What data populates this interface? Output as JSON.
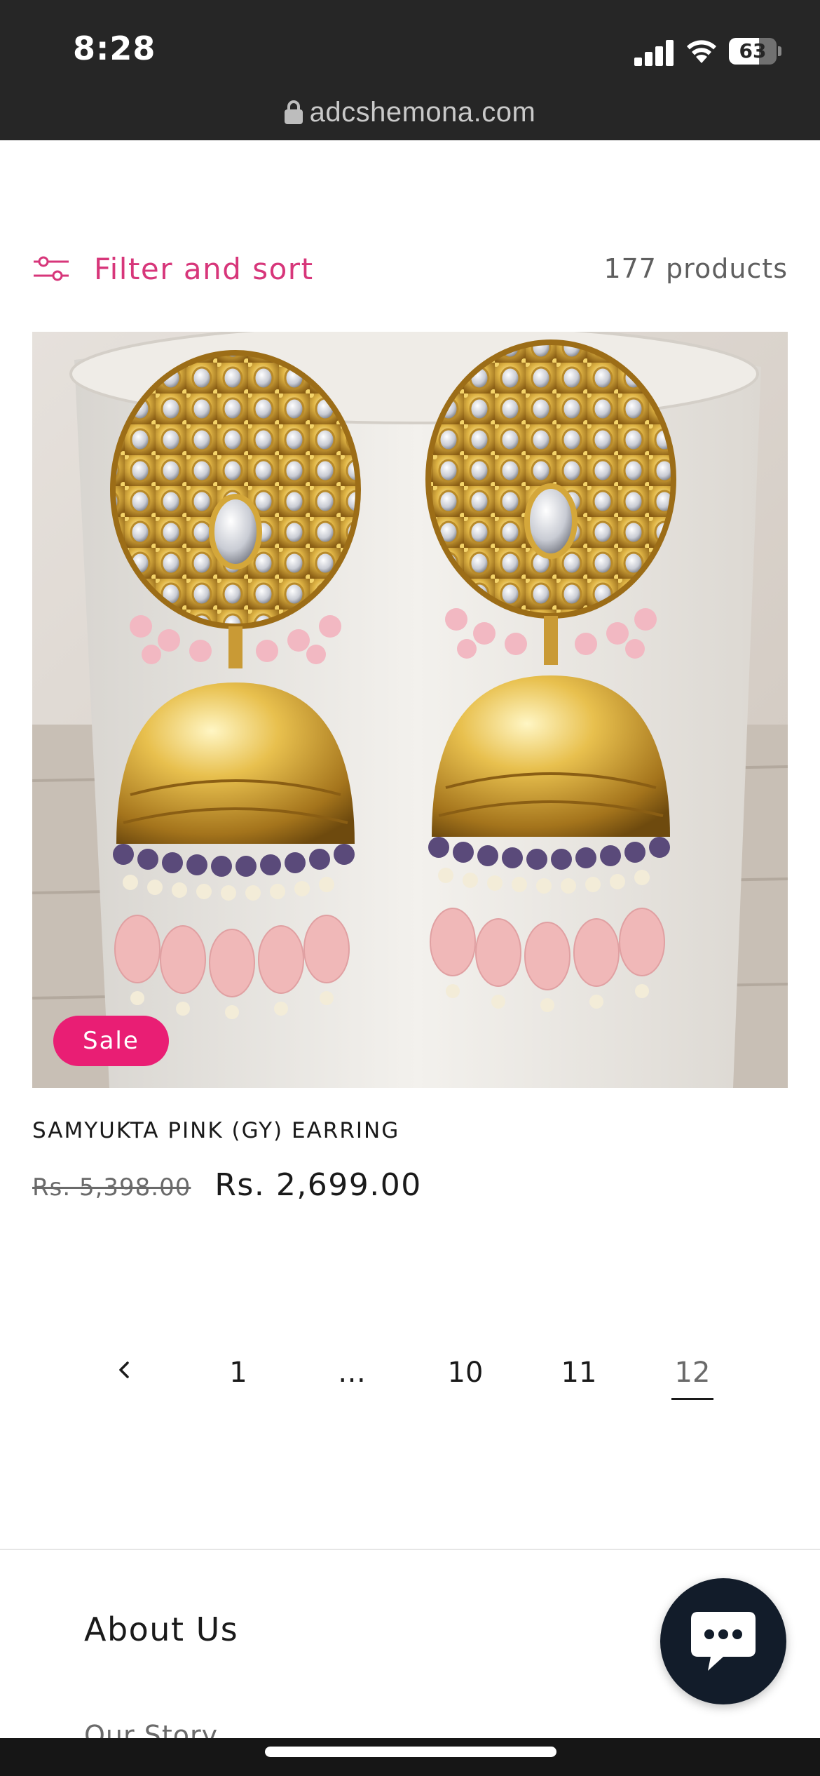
{
  "status_bar": {
    "time": "8:28",
    "battery_percent": "63",
    "battery_level": 0.63
  },
  "browser": {
    "url": "adcshemona.com"
  },
  "collection": {
    "filter_label": "Filter and sort",
    "product_count": "177 products"
  },
  "product": {
    "badge": "Sale",
    "title": "SAMYUKTA PINK (GY) EARRING",
    "price_original": "Rs. 5,398.00",
    "price_sale": "Rs. 2,699.00"
  },
  "pagination": {
    "pages": [
      "1",
      "…",
      "10",
      "11",
      "12"
    ],
    "current": "12"
  },
  "footer": {
    "heading": "About Us",
    "link": "Our Story"
  },
  "colors": {
    "accent": "#d7367a",
    "sale_badge": "#e91e74",
    "status_bar": "#262626",
    "chat_button": "#121c2a"
  }
}
